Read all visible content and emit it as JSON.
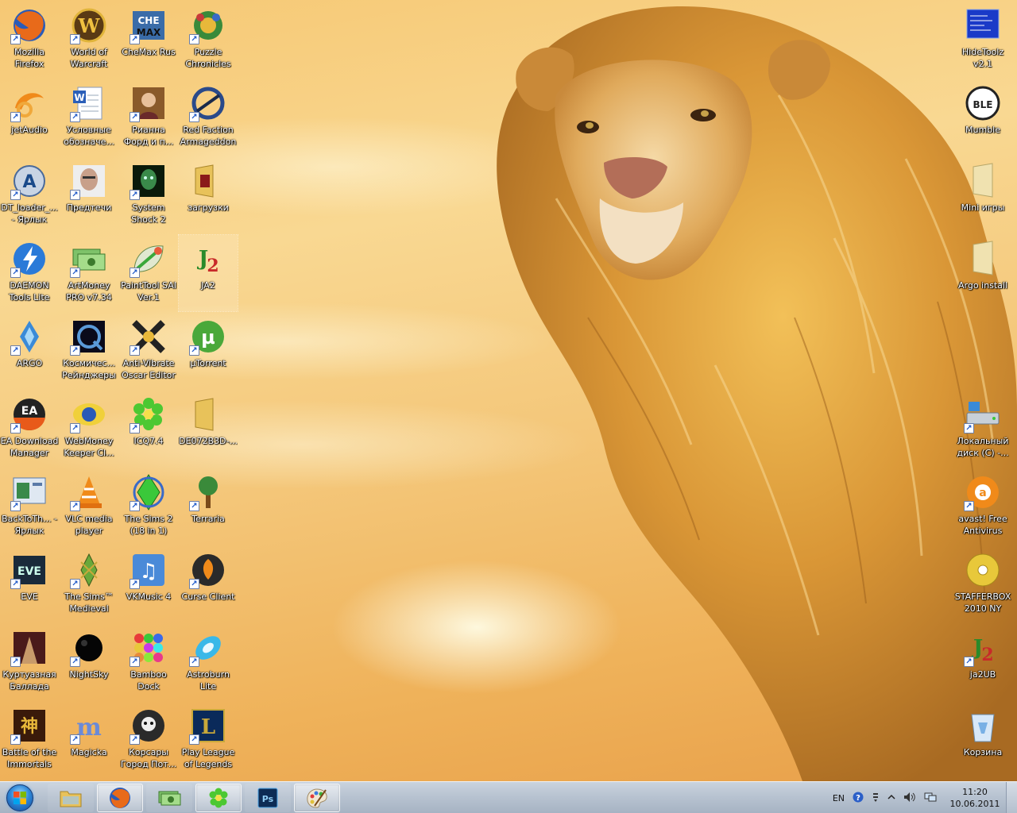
{
  "desktop": {
    "left_column_1": [
      {
        "name": "mozilla-firefox-icon",
        "label": "Mozilla Firefox"
      },
      {
        "name": "jetaudio-icon",
        "label": "jetAudio"
      },
      {
        "name": "dt-loader-icon",
        "label": "DT_loader_... - Ярлык"
      },
      {
        "name": "daemon-tools-icon",
        "label": "DAEMON Tools Lite"
      },
      {
        "name": "argo-icon",
        "label": "ARGO"
      },
      {
        "name": "ea-download-manager-icon",
        "label": "EA Download Manager"
      },
      {
        "name": "backtoth-icon",
        "label": "BackToTh... - Ярлык"
      },
      {
        "name": "eve-icon",
        "label": "EVE"
      },
      {
        "name": "kurtuaznaya-ballada-icon",
        "label": "Куртуазная Баллада"
      },
      {
        "name": "battle-of-the-immortals-icon",
        "label": "Battle of the Immortals"
      }
    ],
    "left_column_2": [
      {
        "name": "world-of-warcraft-icon",
        "label": "World of Warcraft"
      },
      {
        "name": "word-document-icon",
        "label": "Условные обозначе..."
      },
      {
        "name": "predtechi-icon",
        "label": "Предтечи"
      },
      {
        "name": "artmoney-icon",
        "label": "ArtMoney PRO v7.34"
      },
      {
        "name": "kosmicheskie-reinjery-icon",
        "label": "Космичес... Рейнджеры"
      },
      {
        "name": "webmoney-keeper-icon",
        "label": "WebMoney Keeper Cl..."
      },
      {
        "name": "vlc-media-player-icon",
        "label": "VLC media player"
      },
      {
        "name": "sims-medieval-icon",
        "label": "The Sims™ Medieval"
      },
      {
        "name": "nightsky-icon",
        "label": "NightSky"
      },
      {
        "name": "magicka-icon",
        "label": "Magicka"
      }
    ],
    "left_column_3": [
      {
        "name": "chemax-rus-icon",
        "label": "CheMax Rus"
      },
      {
        "name": "rianna-ford-icon",
        "label": "Рианна Форд и п..."
      },
      {
        "name": "system-shock-2-icon",
        "label": "System Shock 2"
      },
      {
        "name": "painttool-sai-icon",
        "label": "PaintTool SAI Ver.1"
      },
      {
        "name": "anti-vibrate-icon",
        "label": "Anti-Vibrate Oscar Editor"
      },
      {
        "name": "icq-icon",
        "label": "ICQ7.4"
      },
      {
        "name": "sims-2-icon",
        "label": "The Sims 2 (18 in 1)"
      },
      {
        "name": "vkmusic-icon",
        "label": "VKMusic 4"
      },
      {
        "name": "bamboo-dock-icon",
        "label": "Bamboo Dock"
      },
      {
        "name": "korsary-icon",
        "label": "Корсары Город Пот..."
      }
    ],
    "left_column_4": [
      {
        "name": "puzzle-chronicles-icon",
        "label": "Puzzle Chronicles"
      },
      {
        "name": "red-faction-icon",
        "label": "Red Faction Armageddon"
      },
      {
        "name": "zagruzki-folder-icon",
        "label": "загрузки"
      },
      {
        "name": "ja2-icon",
        "label": "JA2"
      },
      {
        "name": "utorrent-icon",
        "label": "µTorrent"
      },
      {
        "name": "de072b3d-folder-icon",
        "label": "DE072B3D-..."
      },
      {
        "name": "terraria-icon",
        "label": "Terraria"
      },
      {
        "name": "curse-client-icon",
        "label": "Curse Client"
      },
      {
        "name": "astroburn-icon",
        "label": "Astroburn Lite"
      },
      {
        "name": "league-of-legends-icon",
        "label": "Play League of Legends"
      }
    ],
    "right_column": [
      {
        "name": "hidetoolz-icon",
        "label": "HideToolz v2.1"
      },
      {
        "name": "mumble-icon",
        "label": "Mumble"
      },
      {
        "name": "mini-igry-folder-icon",
        "label": "Mini игры"
      },
      {
        "name": "argo-install-folder-icon",
        "label": "Argo install"
      },
      {
        "name": "local-disk-icon",
        "label": "Локальный диск (C) -..."
      },
      {
        "name": "avast-icon",
        "label": "avast! Free Antivirus"
      },
      {
        "name": "stafferbox-icon",
        "label": "STAFFERBOX 2010 NY"
      },
      {
        "name": "ja2ub-icon",
        "label": "ja2UB"
      },
      {
        "name": "recycle-bin-icon",
        "label": "Корзина"
      }
    ]
  },
  "taskbar": {
    "language": "EN",
    "clock": {
      "time": "11:20",
      "date": "10.06.2011"
    }
  }
}
